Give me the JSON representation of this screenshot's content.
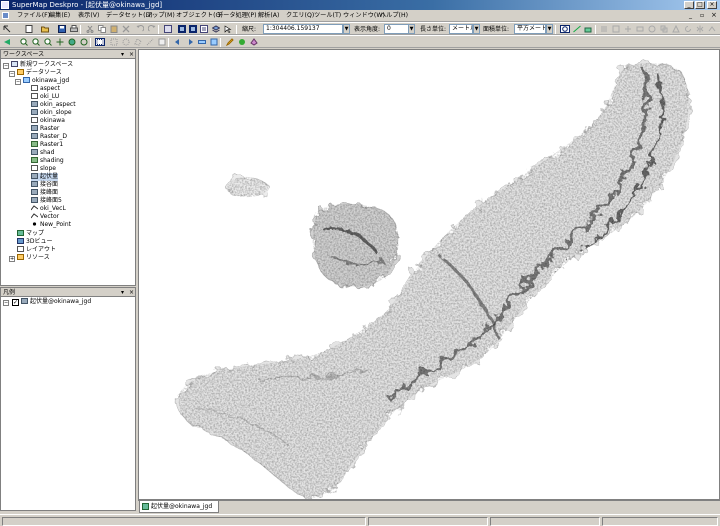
{
  "window": {
    "title": "SuperMap Deskpro - [起伏量@okinawa_jgd]"
  },
  "menu": [
    {
      "label": "ファイル(F)"
    },
    {
      "label": "編集(E)"
    },
    {
      "label": "表示(V)"
    },
    {
      "label": "データセット(D)"
    },
    {
      "label": "マップ(M)"
    },
    {
      "label": "オブジェクト(O)"
    },
    {
      "label": "データ処理(P)"
    },
    {
      "label": "解析(A)"
    },
    {
      "label": "クエリ(Q)"
    },
    {
      "label": "ツール(T)"
    },
    {
      "label": "ウィンドウ(W)"
    },
    {
      "label": "ヘルプ(H)"
    }
  ],
  "toolbar": {
    "scale_label": "縮尺:",
    "scale_value": "1:304406.159137",
    "angle_label": "表示角度:",
    "angle_value": "0",
    "length_unit_label": "長さ単位:",
    "length_unit_value": "メートル",
    "area_unit_label": "面積単位:",
    "area_unit_value": "平方メートル"
  },
  "workspace": {
    "title": "ワークスペース",
    "root": "新規ワークスペース",
    "datasources": "データソース",
    "datasource_name": "okinawa_jgd",
    "datasets": [
      {
        "name": "aspect",
        "icon": "grid-icon"
      },
      {
        "name": "oki_LU",
        "icon": "grid-icon"
      },
      {
        "name": "okin_aspect",
        "icon": "raster-icon"
      },
      {
        "name": "okin_slope",
        "icon": "raster-icon"
      },
      {
        "name": "okinawa",
        "icon": "grid-icon"
      },
      {
        "name": "Raster",
        "icon": "raster-icon"
      },
      {
        "name": "Raster_D",
        "icon": "raster-icon"
      },
      {
        "name": "Raster1",
        "icon": "image-icon"
      },
      {
        "name": "shad",
        "icon": "raster-icon"
      },
      {
        "name": "shading",
        "icon": "image-icon"
      },
      {
        "name": "slope",
        "icon": "grid-icon"
      },
      {
        "name": "起伏量",
        "icon": "raster-icon"
      },
      {
        "name": "接谷面",
        "icon": "raster-icon"
      },
      {
        "name": "接峰面",
        "icon": "raster-icon"
      },
      {
        "name": "接峰面5",
        "icon": "raster-icon"
      },
      {
        "name": "oki_VecL",
        "icon": "line-icon"
      },
      {
        "name": "Vector",
        "icon": "line-icon"
      },
      {
        "name": "New_Point",
        "icon": "point-icon"
      }
    ],
    "nodes": [
      "マップ",
      "3Dビュー",
      "レイアウト",
      "リソース"
    ]
  },
  "legend": {
    "title": "凡例",
    "item": "起伏量@okinawa_jgd"
  },
  "map_tab": {
    "label": "起伏量@okinawa_jgd"
  },
  "colors": {
    "title_start": "#0a246a",
    "title_end": "#a6caf0",
    "selected": "#c7d9f0",
    "chrome": "#d4d0c8"
  }
}
